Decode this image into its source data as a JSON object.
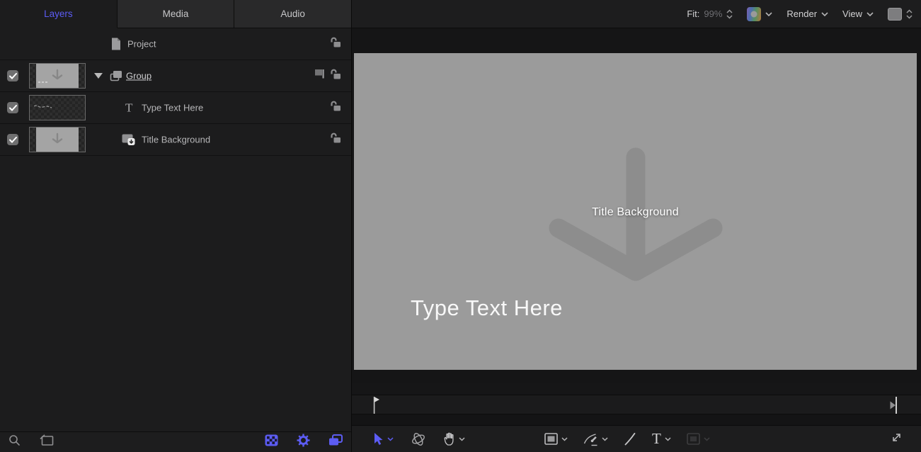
{
  "colors": {
    "accent_blue": "#5c5cf5",
    "panel_bg": "#1c1c1d",
    "tab_inactive_bg": "#29292a",
    "canvas_bg": "#9b9b9b",
    "canvas_arrow": "#8d8d8d",
    "toolbar_bg": "#1d1d1e"
  },
  "tabs": [
    {
      "label": "Layers",
      "active": true
    },
    {
      "label": "Media",
      "active": false
    },
    {
      "label": "Audio",
      "active": false
    }
  ],
  "layers_panel": {
    "project_label": "Project",
    "rows": [
      {
        "label": "Group",
        "type": "group",
        "checked": true,
        "expanded": true,
        "selected": true,
        "locked": false
      },
      {
        "label": "Type Text Here",
        "type": "text",
        "checked": true,
        "locked": false
      },
      {
        "label": "Title Background",
        "type": "media",
        "checked": true,
        "locked": false
      }
    ],
    "footer_icons": [
      "search-icon",
      "filter-icon",
      "checkerboard-icon",
      "gear-icon",
      "layers-stack-icon"
    ]
  },
  "viewer_toolbar": {
    "fit_label": "Fit:",
    "fit_value": "99%",
    "render_label": "Render",
    "view_label": "View",
    "icons": [
      "zoom-stepper",
      "color-channels-swatch",
      "render-dropdown",
      "view-dropdown",
      "display-swatch-stepper"
    ]
  },
  "canvas": {
    "arrow_label": "Title Background",
    "placeholder_text": "Type Text Here"
  },
  "timeline": {
    "markers": [
      "playhead-at-start",
      "end-marker-at-right"
    ]
  },
  "tools_bar": {
    "tools": [
      "select-tool (active)",
      "transform-3d-tool",
      "pan-tool",
      "rectangle-tool",
      "bezier-tool",
      "paint-stroke-tool",
      "text-tool",
      "mask-tool (disabled)",
      "expand-view"
    ]
  },
  "glyphs": {
    "text_layer_glyph": "T",
    "text_tool_glyph": "T"
  }
}
